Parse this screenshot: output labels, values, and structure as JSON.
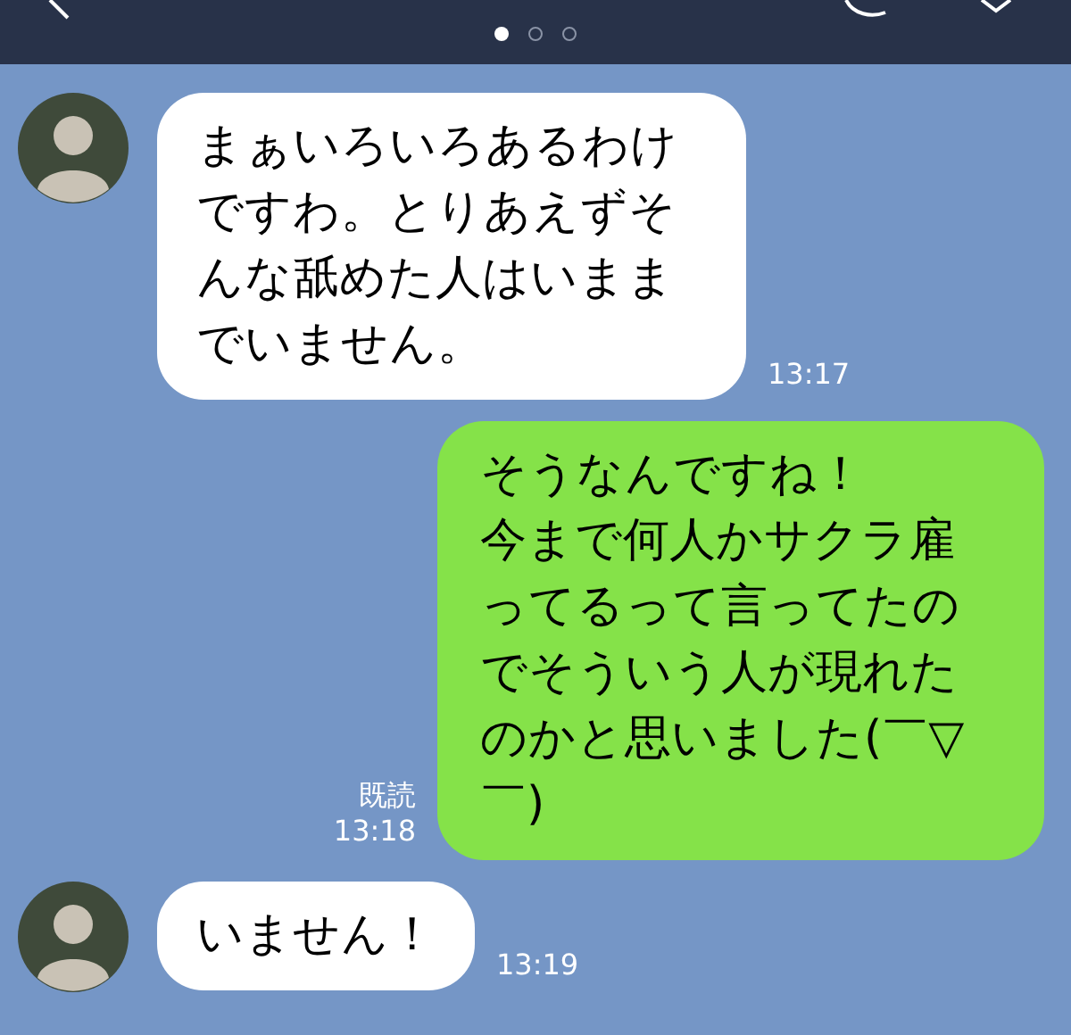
{
  "header": {
    "page_dots": [
      {
        "selected": true
      },
      {
        "selected": false
      },
      {
        "selected": false
      }
    ]
  },
  "messages": [
    {
      "kind": "incoming",
      "text": "まぁいろいろあるわけですわ。とりあえずそんな舐めた人はいままでいません。",
      "time": "13:17"
    },
    {
      "kind": "outgoing",
      "paragraphs": [
        "そうなんですね！",
        "今まで何人かサクラ雇ってるって言ってたのでそういう人が現れたのかと思いました(￣▽￣)"
      ],
      "read": "既読",
      "time": "13:18"
    },
    {
      "kind": "incoming",
      "text": "いません！",
      "time": "13:19"
    }
  ]
}
